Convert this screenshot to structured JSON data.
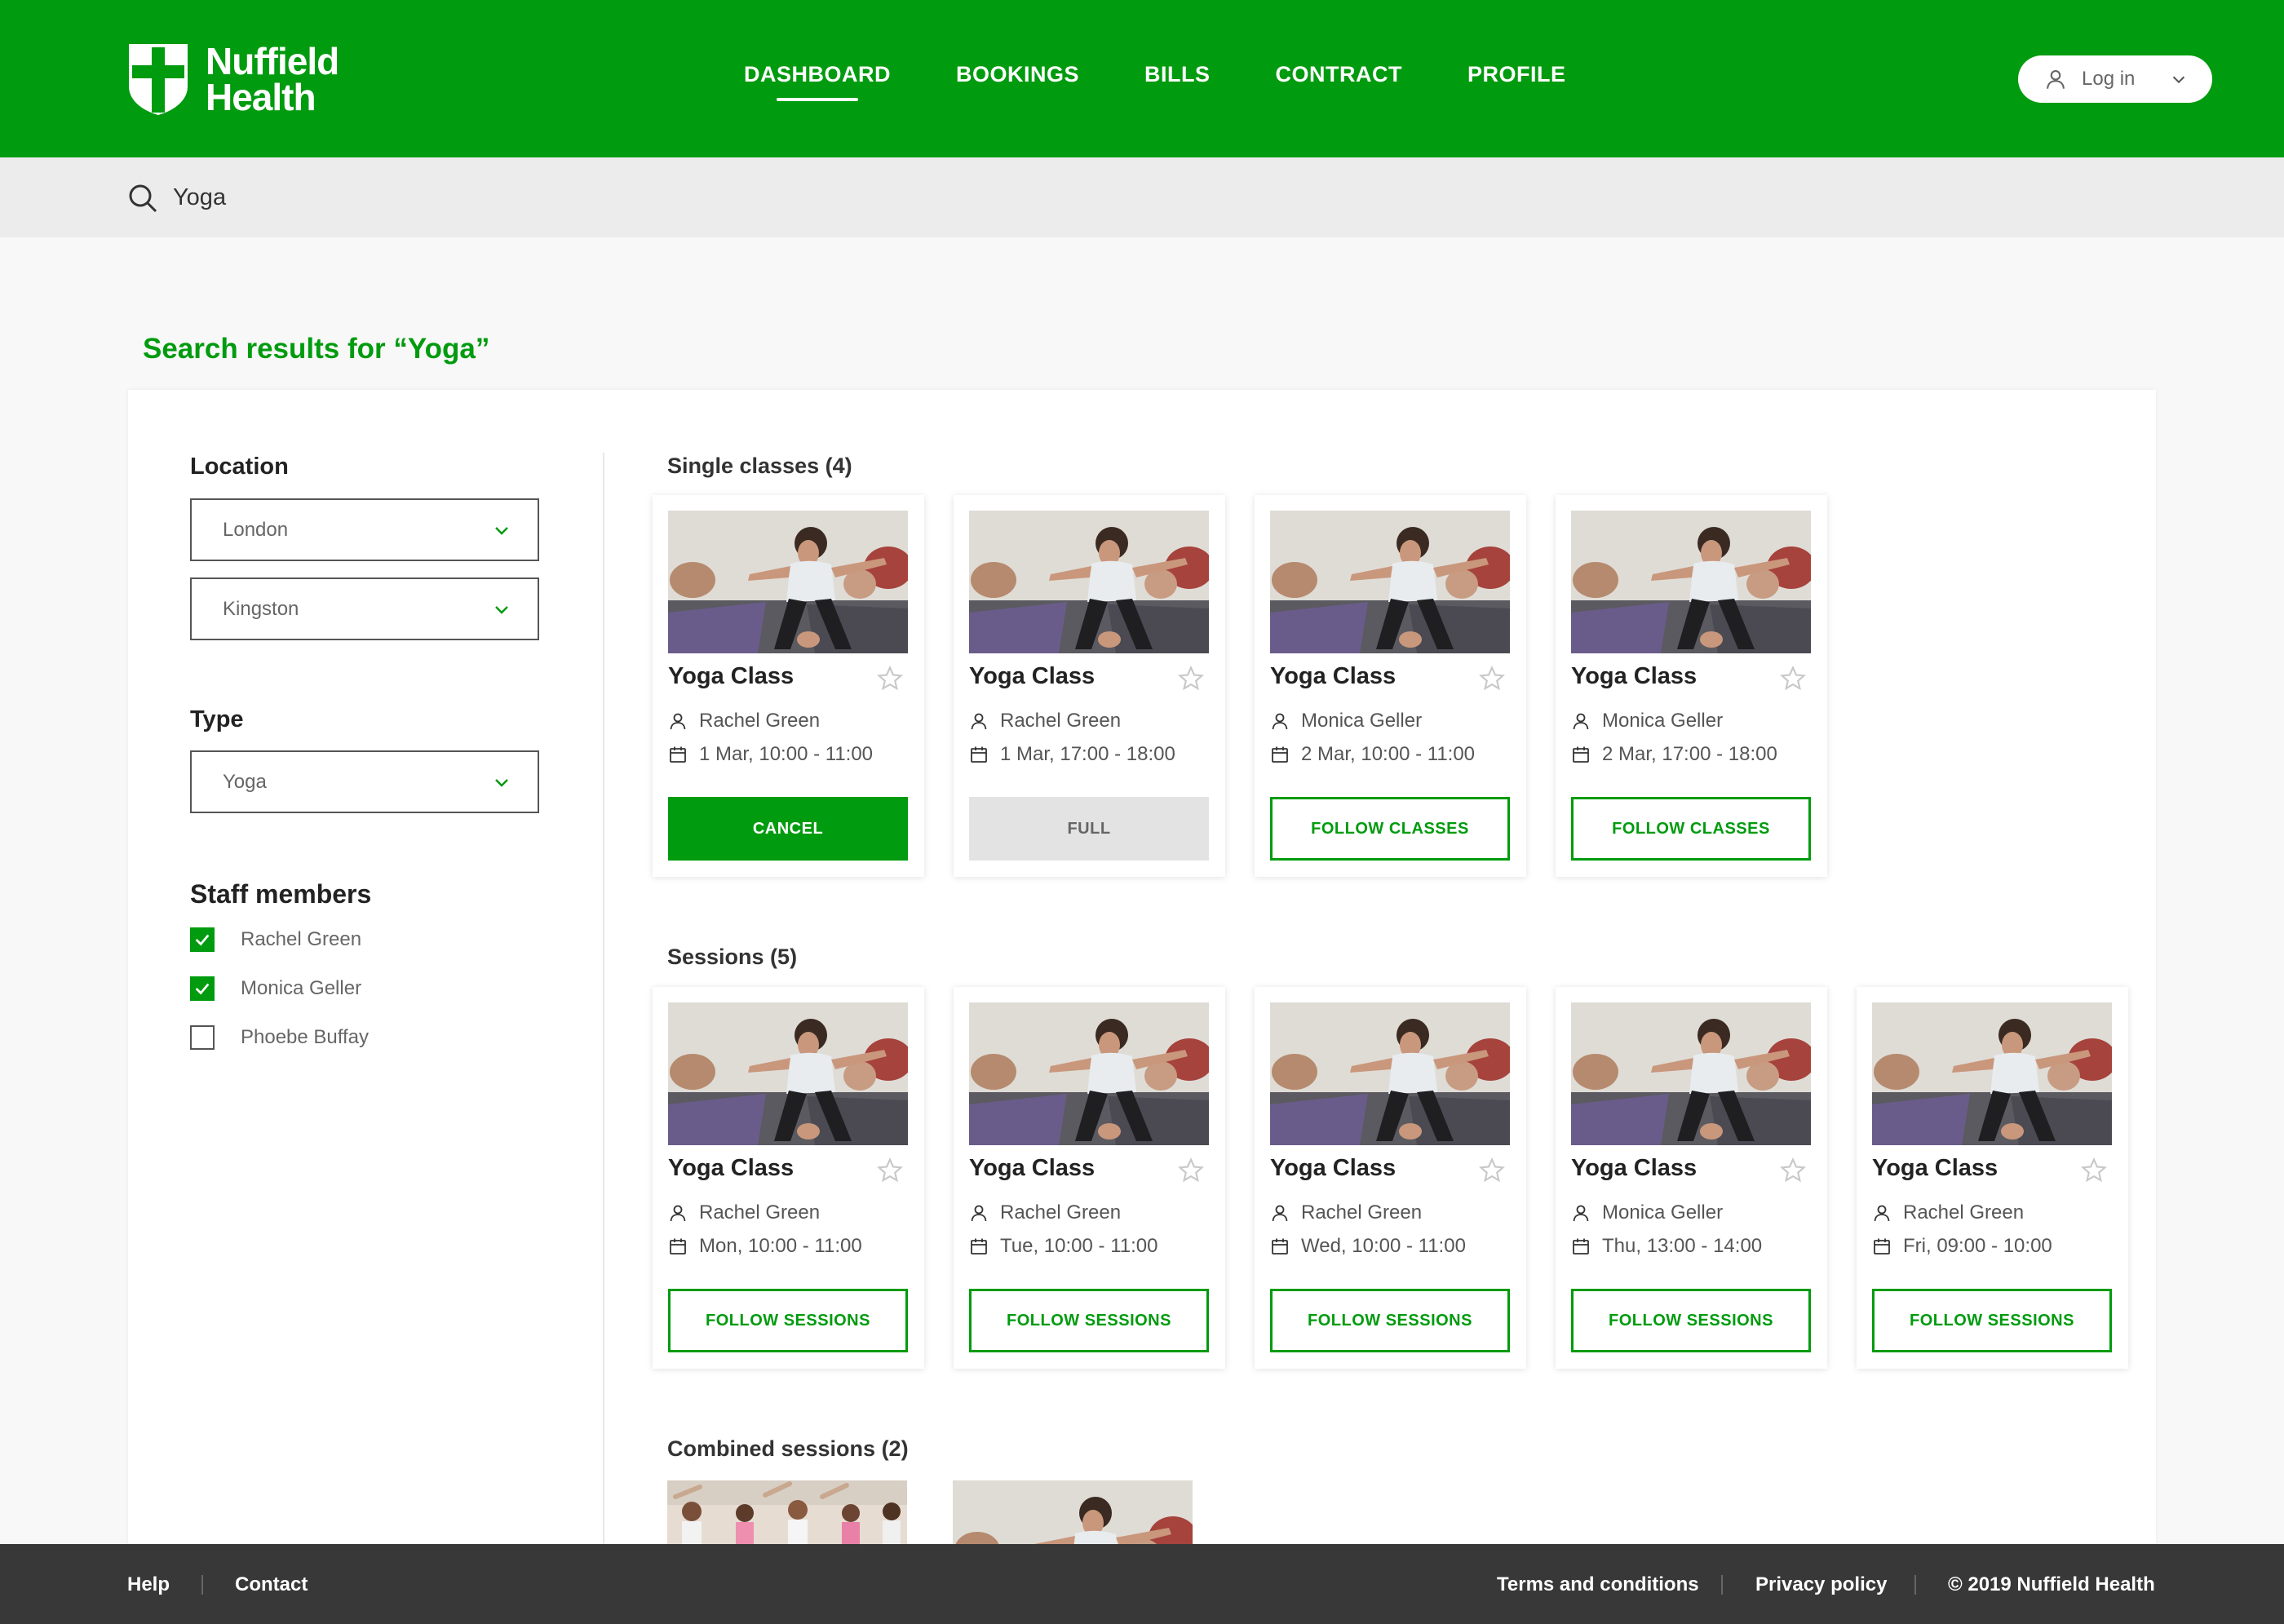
{
  "brand": {
    "name_line1": "Nuffield",
    "name_line2": "Health",
    "color": "#009b0e"
  },
  "nav": {
    "items": [
      {
        "label": "DASHBOARD",
        "active": true
      },
      {
        "label": "BOOKINGS",
        "active": false
      },
      {
        "label": "BILLS",
        "active": false
      },
      {
        "label": "CONTRACT",
        "active": false
      },
      {
        "label": "PROFILE",
        "active": false
      }
    ],
    "login_label": "Log in"
  },
  "search": {
    "value": "Yoga",
    "icon": "search-icon"
  },
  "results_title": "Search results for “Yoga”",
  "filters": {
    "location_label": "Location",
    "location_values": [
      "London",
      "Kingston"
    ],
    "type_label": "Type",
    "type_value": "Yoga",
    "staff_label": "Staff members",
    "staff": [
      {
        "name": "Rachel Green",
        "checked": true
      },
      {
        "name": "Monica Geller",
        "checked": true
      },
      {
        "name": "Phoebe Buffay",
        "checked": false
      }
    ]
  },
  "single_classes": {
    "title": "Single classes (4)",
    "cards": [
      {
        "title": "Yoga Class",
        "instructor": "Rachel Green",
        "time": "1 Mar, 10:00 - 11:00",
        "button": "CANCEL",
        "button_style": "primary"
      },
      {
        "title": "Yoga Class",
        "instructor": "Rachel Green",
        "time": "1 Mar, 17:00 - 18:00",
        "button": "FULL",
        "button_style": "disabled"
      },
      {
        "title": "Yoga Class",
        "instructor": "Monica Geller",
        "time": "2 Mar, 10:00 - 11:00",
        "button": "FOLLOW CLASSES",
        "button_style": "outline"
      },
      {
        "title": "Yoga Class",
        "instructor": "Monica Geller",
        "time": "2 Mar, 17:00 - 18:00",
        "button": "FOLLOW CLASSES",
        "button_style": "outline"
      }
    ]
  },
  "sessions": {
    "title": "Sessions (5)",
    "cards": [
      {
        "title": "Yoga Class",
        "instructor": "Rachel Green",
        "time": "Mon, 10:00 - 11:00",
        "button": "FOLLOW SESSIONS",
        "button_style": "outline"
      },
      {
        "title": "Yoga Class",
        "instructor": "Rachel Green",
        "time": "Tue, 10:00 - 11:00",
        "button": "FOLLOW SESSIONS",
        "button_style": "outline"
      },
      {
        "title": "Yoga Class",
        "instructor": "Rachel Green",
        "time": "Wed, 10:00 - 11:00",
        "button": "FOLLOW SESSIONS",
        "button_style": "outline"
      },
      {
        "title": "Yoga Class",
        "instructor": "Monica Geller",
        "time": "Thu, 13:00 - 14:00",
        "button": "FOLLOW SESSIONS",
        "button_style": "outline"
      },
      {
        "title": "Yoga Class",
        "instructor": "Rachel Green",
        "time": "Fri, 09:00 - 10:00",
        "button": "FOLLOW SESSIONS",
        "button_style": "outline"
      }
    ]
  },
  "combined_sessions": {
    "title": "Combined sessions (2)"
  },
  "footer": {
    "help": "Help",
    "contact": "Contact",
    "terms": "Terms and conditions",
    "privacy": "Privacy policy",
    "copyright": "© 2019 Nuffield Health"
  }
}
